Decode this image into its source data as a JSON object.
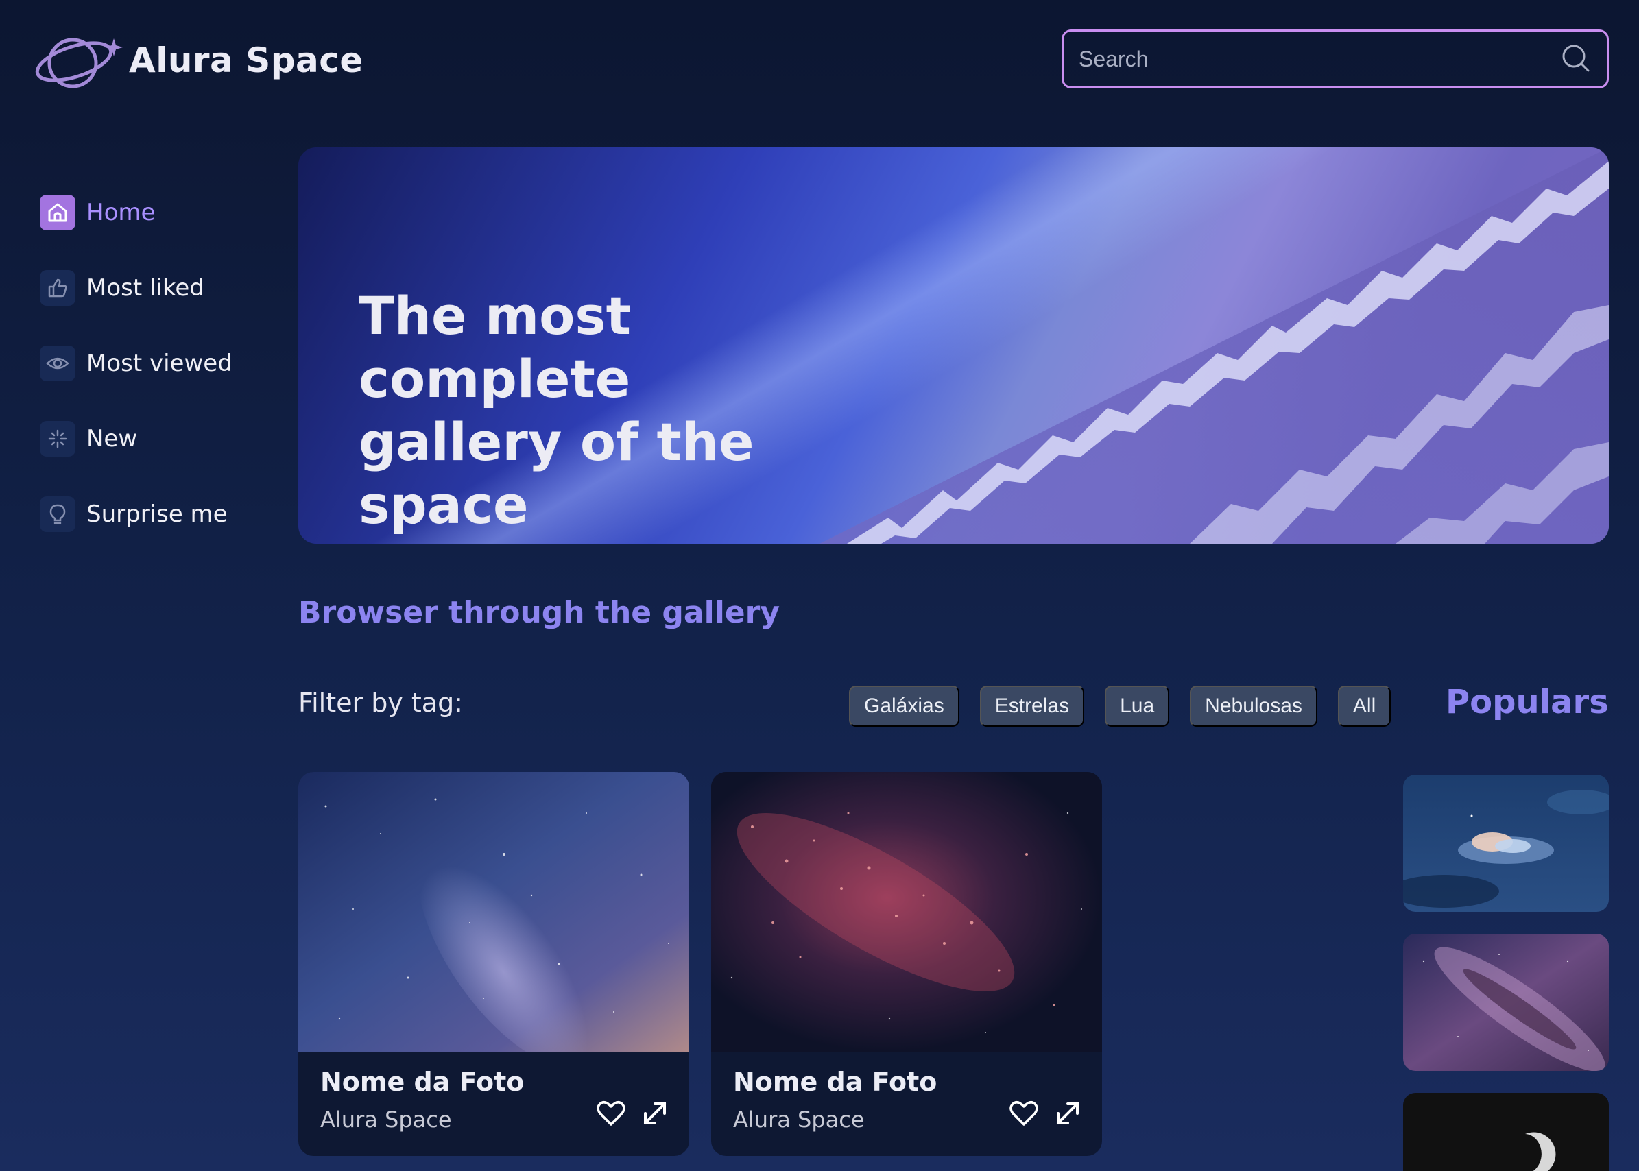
{
  "header": {
    "logo_text": "Alura Space",
    "search": {
      "placeholder": "Search",
      "value": ""
    }
  },
  "sidebar": {
    "items": [
      {
        "label": "Home",
        "icon": "home-icon",
        "active": true
      },
      {
        "label": "Most liked",
        "icon": "thumbs-up-icon",
        "active": false
      },
      {
        "label": "Most viewed",
        "icon": "eye-icon",
        "active": false
      },
      {
        "label": "New",
        "icon": "sparkle-icon",
        "active": false
      },
      {
        "label": "Surprise me",
        "icon": "lightbulb-icon",
        "active": false
      }
    ]
  },
  "banner": {
    "title_line1": "The most complete",
    "title_line2": "gallery of the space"
  },
  "gallery": {
    "title": "Browser through the gallery",
    "filter_label": "Filter by tag:",
    "tags": [
      "Galáxias",
      "Estrelas",
      "Lua",
      "Nebulosas",
      "All"
    ],
    "cards": [
      {
        "title": "Nome da Foto",
        "author": "Alura Space"
      },
      {
        "title": "Nome da Foto",
        "author": "Alura Space"
      }
    ]
  },
  "populars": {
    "title": "Populars"
  },
  "colors": {
    "background": "#0c1631",
    "accent": "#8c84f0",
    "search_border": "#c98ef0",
    "tag_bg": "#3a4863",
    "active_icon_bg": "#a374e0"
  }
}
